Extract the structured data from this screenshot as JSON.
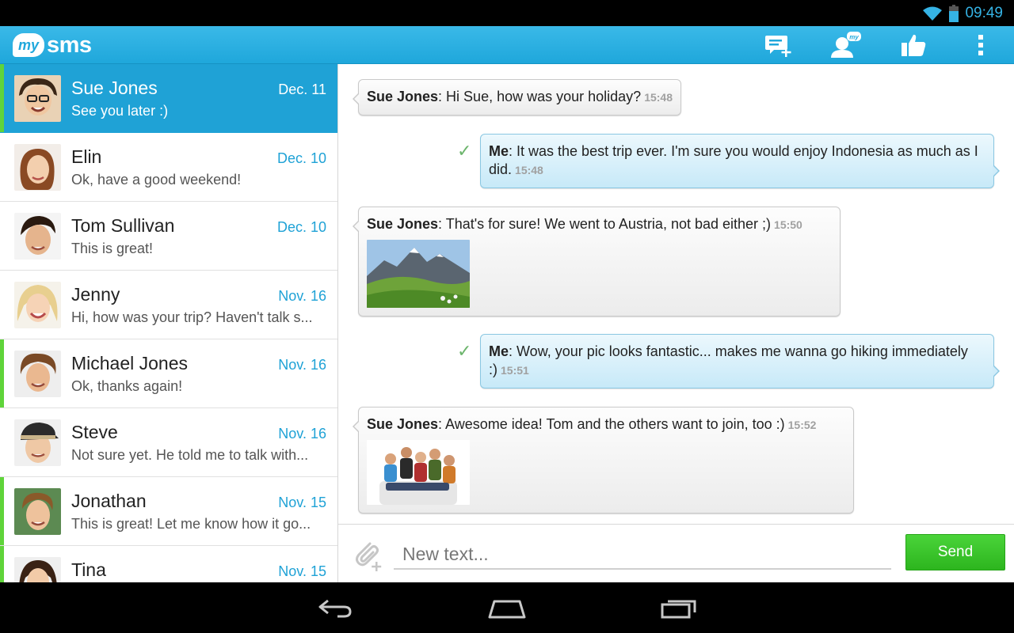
{
  "status_bar": {
    "time": "09:49",
    "icons": [
      "wifi-icon",
      "battery-icon"
    ]
  },
  "app": {
    "logo_bubble": "my",
    "logo_text": "sms",
    "actions": [
      "new-message-icon",
      "my-contacts-icon",
      "like-icon",
      "overflow-menu-icon"
    ],
    "colors": {
      "accent": "#1fa2d6",
      "unread": "#5fd43a",
      "send": "#33bb24"
    }
  },
  "conversations": [
    {
      "name": "Sue Jones",
      "date": "Dec. 11",
      "preview": "See you later :)"
    },
    {
      "name": "Elin",
      "date": "Dec. 10",
      "preview": "Ok, have a good weekend!"
    },
    {
      "name": "Tom Sullivan",
      "date": "Dec. 10",
      "preview": "This is great!"
    },
    {
      "name": "Jenny",
      "date": "Nov. 16",
      "preview": "Hi, how was your trip? Haven't talk s..."
    },
    {
      "name": "Michael Jones",
      "date": "Nov. 16",
      "preview": "Ok, thanks again!"
    },
    {
      "name": "Steve",
      "date": "Nov. 16",
      "preview": "Not sure yet. He told me to talk with..."
    },
    {
      "name": "Jonathan",
      "date": "Nov. 15",
      "preview": "This is great! Let me know how it go..."
    },
    {
      "name": "Tina",
      "date": "Nov. 15",
      "preview": ""
    }
  ],
  "messages": [
    {
      "sender": "Sue Jones",
      "text": ": Hi Sue, how was your holiday?",
      "time": "15:48"
    },
    {
      "sender": "Me",
      "text": ": It was the best trip ever. I'm sure you would enjoy Indonesia as much as I did.",
      "time": "15:48"
    },
    {
      "sender": "Sue Jones",
      "text": ": That's for sure! We went to Austria, not bad either ;)",
      "time": "15:50"
    },
    {
      "sender": "Me",
      "text": ": Wow, your pic looks fantastic... makes me wanna go hiking immediately :)",
      "time": "15:51"
    },
    {
      "sender": "Sue Jones",
      "text": ": Awesome idea! Tom and the others want to join, too :)",
      "time": "15:52"
    }
  ],
  "composer": {
    "placeholder": "New text...",
    "send_label": "Send"
  }
}
